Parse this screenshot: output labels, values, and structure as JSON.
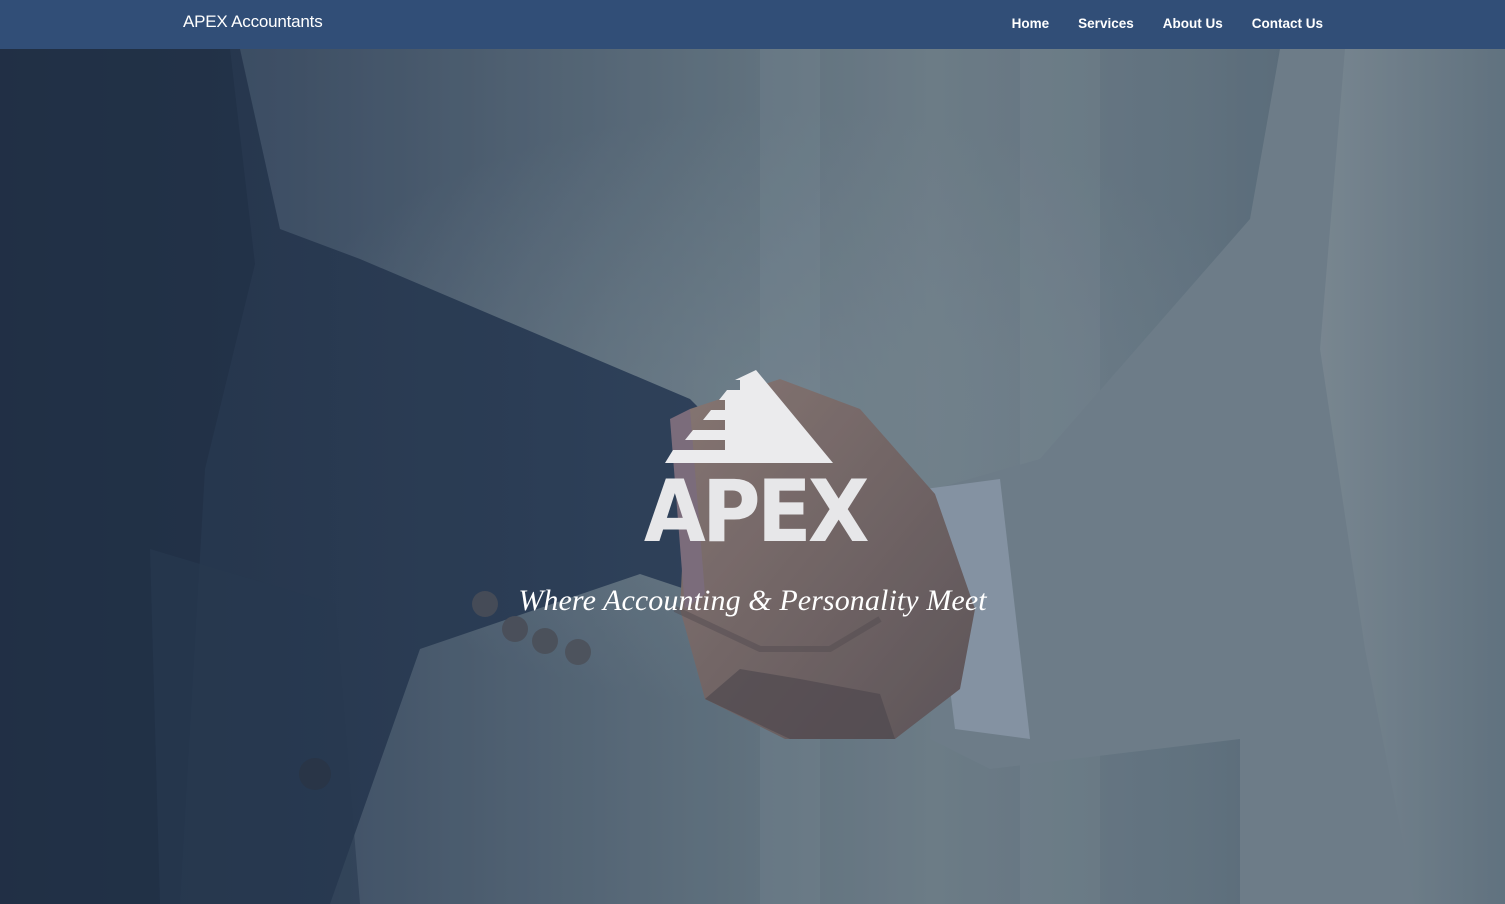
{
  "navbar": {
    "brand": "APEX Accountants",
    "links": [
      {
        "label": "Home"
      },
      {
        "label": "Services"
      },
      {
        "label": "About Us"
      },
      {
        "label": "Contact Us"
      }
    ]
  },
  "hero": {
    "logo_text": "APEX",
    "tagline": "Where Accounting & Personality Meet",
    "image": "business-handshake-photo"
  },
  "colors": {
    "navbar_bg": "#314e77",
    "text": "#ffffff",
    "logo": "#e7e7e9"
  }
}
